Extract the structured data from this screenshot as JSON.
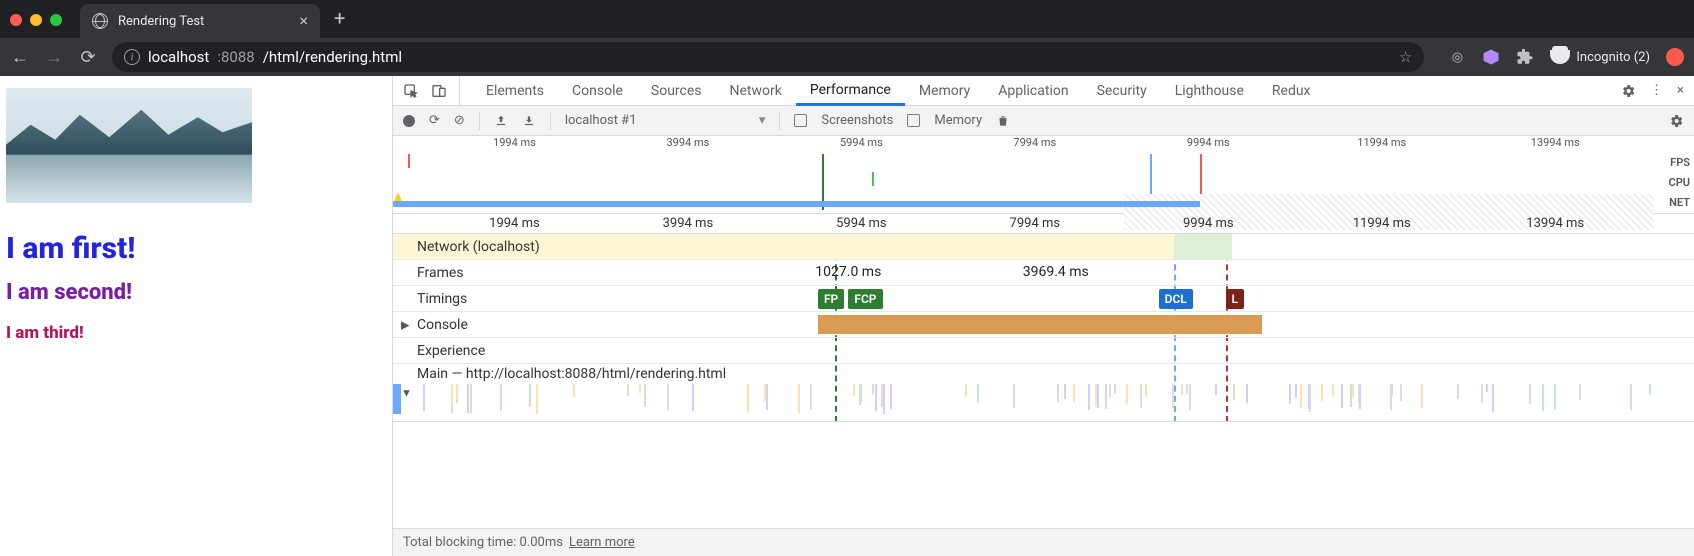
{
  "browser": {
    "tab_title": "Rendering Test",
    "url_host": "localhost",
    "url_port": ":8088",
    "url_path": "/html/rendering.html",
    "incognito_label": "Incognito (2)"
  },
  "page": {
    "h1": "I am first!",
    "h2": "I am second!",
    "h3": "I am third!"
  },
  "devtools": {
    "tabs": [
      "Elements",
      "Console",
      "Sources",
      "Network",
      "Performance",
      "Memory",
      "Application",
      "Security",
      "Lighthouse",
      "Redux"
    ],
    "active_tab": "Performance",
    "toolbar": {
      "profile_select": "localhost #1",
      "screenshots_label": "Screenshots",
      "memory_label": "Memory"
    },
    "overview": {
      "ticks": [
        "1994 ms",
        "3994 ms",
        "5994 ms",
        "7994 ms",
        "9994 ms",
        "11994 ms",
        "13994 ms"
      ],
      "lanes": [
        "FPS",
        "CPU",
        "NET"
      ]
    },
    "ruler_main": [
      "1994 ms",
      "3994 ms",
      "5994 ms",
      "7994 ms",
      "9994 ms",
      "11994 ms",
      "13994 ms"
    ],
    "tracks": {
      "network_label": "Network (localhost)",
      "frames_label": "Frames",
      "frames": [
        "1027.0 ms",
        "3969.4 ms"
      ],
      "timings_label": "Timings",
      "timings": [
        {
          "name": "FP",
          "color": "#2e7d32"
        },
        {
          "name": "FCP",
          "color": "#2e7d32"
        },
        {
          "name": "DCL",
          "color": "#1f6fd1"
        },
        {
          "name": "L",
          "color": "#7a231c"
        }
      ],
      "console_label": "Console",
      "experience_label": "Experience",
      "main_label": "Main — http://localhost:8088/html/rendering.html"
    },
    "footer": {
      "tbt": "Total blocking time: 0.00ms",
      "learn": "Learn more"
    }
  }
}
